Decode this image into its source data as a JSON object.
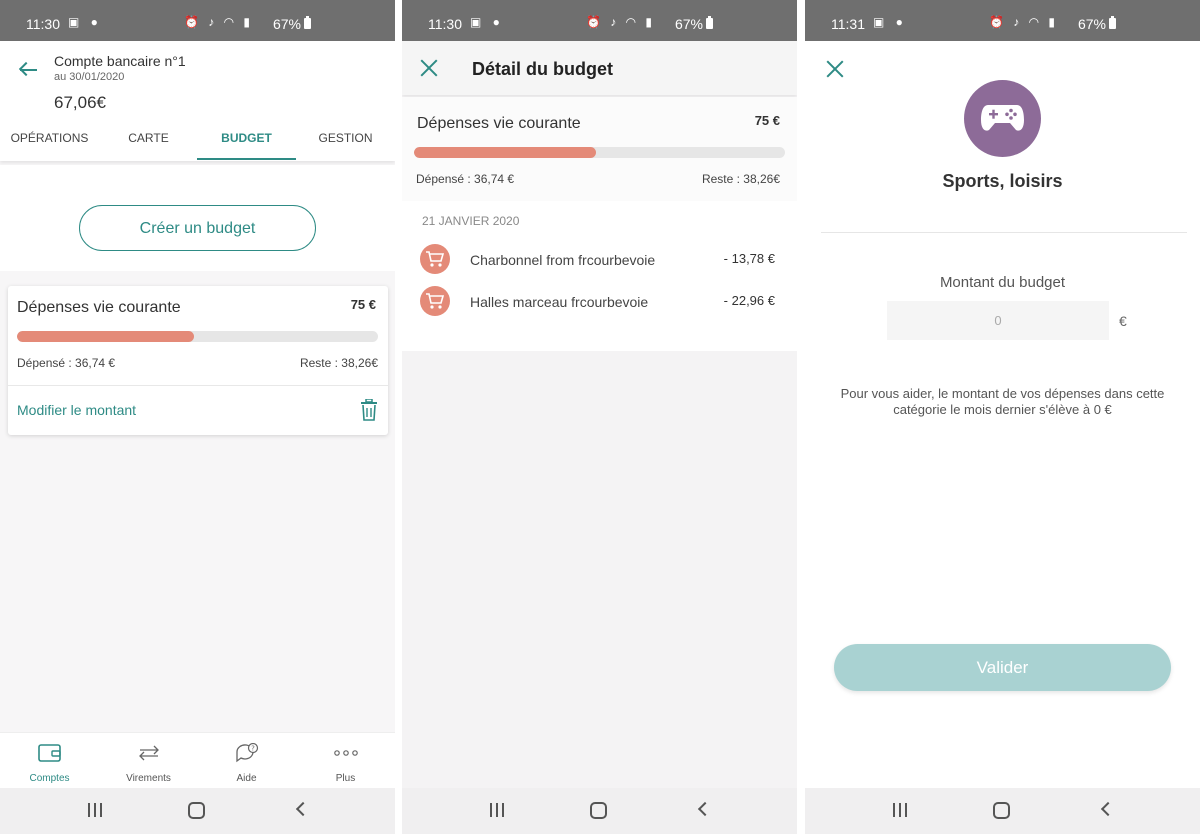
{
  "colors": {
    "accent": "#2e8b85",
    "progress": "#e48a78",
    "category": "#8d6b98",
    "valider_button": "#a9d2d2"
  },
  "screens": [
    {
      "status": {
        "time": "11:30",
        "battery": "67%"
      },
      "header": {
        "account_name": "Compte bancaire n°1",
        "account_date": "au 30/01/2020",
        "balance": "67,06€"
      },
      "tabs": [
        {
          "label": "OPÉRATIONS",
          "active": false
        },
        {
          "label": "CARTE",
          "active": false
        },
        {
          "label": "BUDGET",
          "active": true
        },
        {
          "label": "GESTION",
          "active": false
        }
      ],
      "create_button": "Créer un budget",
      "budget_card": {
        "title": "Dépenses vie courante",
        "total": "75 €",
        "progress": 0.49,
        "spent": "Dépensé : 36,74 €",
        "rest": "Reste : 38,26€",
        "modify": "Modifier le montant",
        "delete_icon": "trash-icon"
      },
      "bottom_nav": [
        {
          "label": "Comptes",
          "icon": "wallet-icon",
          "active": true
        },
        {
          "label": "Virements",
          "icon": "transfer-icon",
          "active": false
        },
        {
          "label": "Aide",
          "icon": "help-chat-icon",
          "active": false
        },
        {
          "label": "Plus",
          "icon": "more-icon",
          "active": false
        }
      ]
    },
    {
      "status": {
        "time": "11:30",
        "battery": "67%"
      },
      "title": "Détail du budget",
      "summary": {
        "title": "Dépenses vie courante",
        "total": "75 €",
        "progress": 0.49,
        "spent": "Dépensé : 36,74 €",
        "rest": "Reste : 38,26€"
      },
      "date_header": "21 JANVIER 2020",
      "transactions": [
        {
          "label": "Charbonnel from frcourbevoie",
          "amount": "- 13,78 €",
          "icon": "cart-icon"
        },
        {
          "label": "Halles marceau frcourbevoie",
          "amount": "- 22,96 €",
          "icon": "cart-icon"
        }
      ]
    },
    {
      "status": {
        "time": "11:31",
        "battery": "67%"
      },
      "category": {
        "name": "Sports, loisirs",
        "icon": "gamepad-icon"
      },
      "amount_label": "Montant du budget",
      "amount_placeholder": "0",
      "currency": "€",
      "help_text": "Pour vous aider, le montant de vos dépenses dans cette catégorie le mois dernier s'élève à 0 €",
      "valider": "Valider"
    }
  ]
}
